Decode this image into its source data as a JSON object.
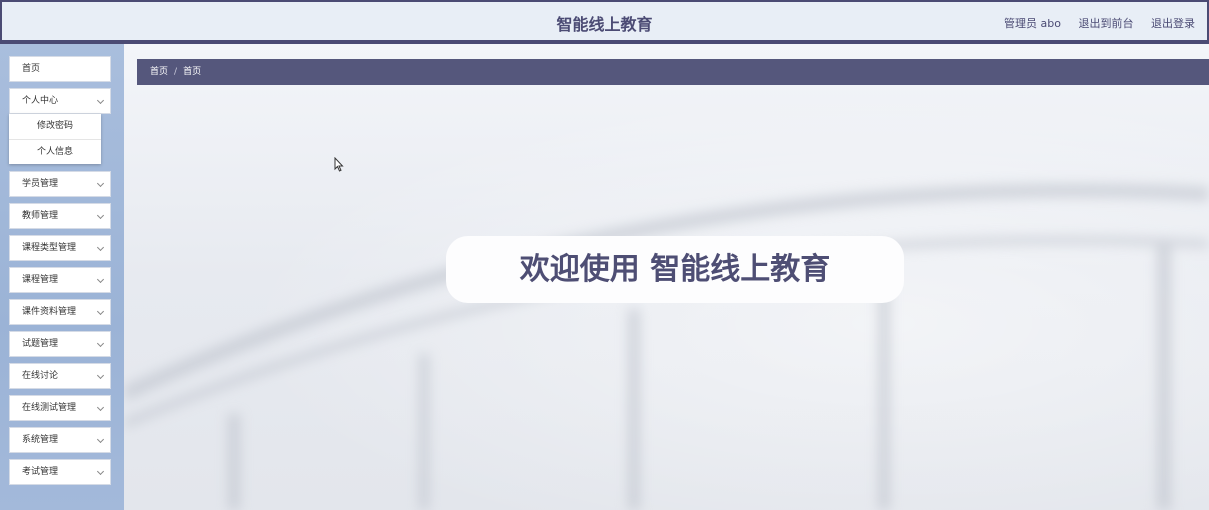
{
  "header": {
    "title": "智能线上教育",
    "admin_label": "管理员 abo",
    "to_front_label": "退出到前台",
    "logout_label": "退出登录"
  },
  "sidebar": {
    "items": [
      {
        "label": "首页",
        "has_children": false
      },
      {
        "label": "个人中心",
        "has_children": true,
        "expanded": true,
        "children": [
          "修改密码",
          "个人信息"
        ]
      },
      {
        "label": "学员管理",
        "has_children": true
      },
      {
        "label": "教师管理",
        "has_children": true
      },
      {
        "label": "课程类型管理",
        "has_children": true
      },
      {
        "label": "课程管理",
        "has_children": true
      },
      {
        "label": "课件资料管理",
        "has_children": true
      },
      {
        "label": "试题管理",
        "has_children": true
      },
      {
        "label": "在线讨论",
        "has_children": true
      },
      {
        "label": "在线测试管理",
        "has_children": true
      },
      {
        "label": "系统管理",
        "has_children": true
      },
      {
        "label": "考试管理",
        "has_children": true
      }
    ]
  },
  "breadcrumb": {
    "items": [
      "首页",
      "首页"
    ],
    "separator": "/"
  },
  "welcome": {
    "text": "欢迎使用 智能线上教育"
  },
  "colors": {
    "accent": "#4b4b74",
    "breadcrumb_bg": "#55577c",
    "sidebar_bg": "#a3b9da"
  }
}
